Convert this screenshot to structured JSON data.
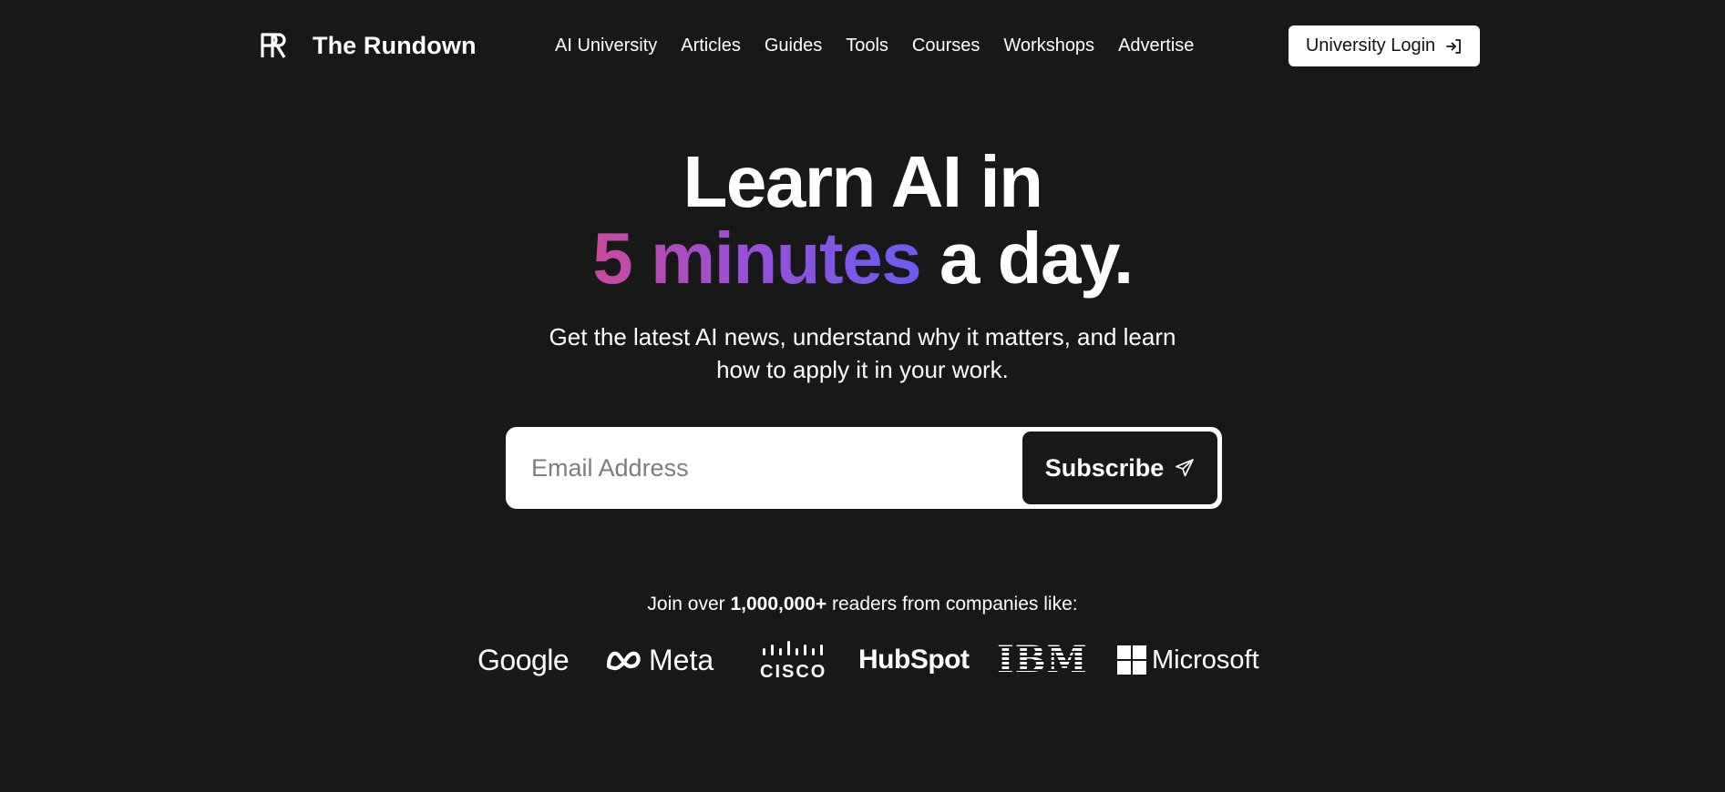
{
  "header": {
    "brand_name": "The Rundown",
    "nav": [
      {
        "label": "AI University"
      },
      {
        "label": "Articles"
      },
      {
        "label": "Guides"
      },
      {
        "label": "Tools"
      },
      {
        "label": "Courses"
      },
      {
        "label": "Workshops"
      },
      {
        "label": "Advertise"
      }
    ],
    "login_label": "University Login"
  },
  "hero": {
    "title_line1": "Learn AI in",
    "title_highlight": "5 minutes",
    "title_rest": " a day.",
    "subtitle_line1": "Get the latest AI news, understand why it matters, and learn",
    "subtitle_line2": "how to apply it in your work."
  },
  "subscribe": {
    "placeholder": "Email Address",
    "button_label": "Subscribe"
  },
  "social_proof": {
    "prefix": "Join over ",
    "count": "1,000,000+",
    "suffix": " readers from companies like:"
  },
  "companies": {
    "google": "Google",
    "meta": "Meta",
    "cisco": "CISCO",
    "hubspot": "HubSpot",
    "ibm": "IBM",
    "microsoft": "Microsoft"
  },
  "colors": {
    "background": "#181818",
    "text": "#ffffff",
    "gradient_start": "#c84a9c",
    "gradient_end": "#6b5cf0"
  },
  "icons": {
    "brand": "rundown-logo-icon",
    "login": "login-arrow-icon",
    "subscribe": "paper-plane-icon"
  }
}
